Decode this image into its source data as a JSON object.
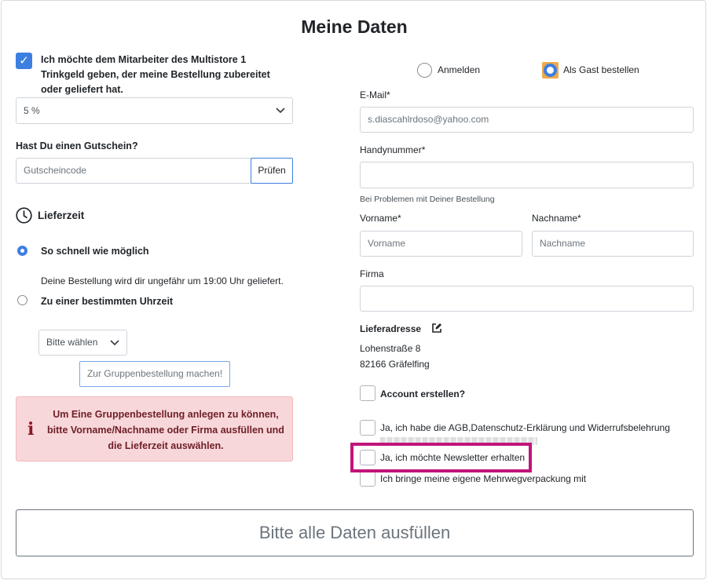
{
  "title": "Meine Daten",
  "tip": {
    "checked": true,
    "text": "Ich möchte dem Mitarbeiter des Multistore 1 Trinkgeld geben, der meine Bestellung zubereitet oder geliefert hat.",
    "selected": "5 %"
  },
  "voucher": {
    "label": "Hast Du einen Gutschein?",
    "placeholder": "Gutscheincode",
    "button": "Prüfen"
  },
  "delivery": {
    "heading": "Lieferzeit",
    "option_asap": "So schnell wie möglich",
    "asap_note": "Deine Bestellung wird dir ungefähr um 19:00 Uhr geliefert.",
    "option_time": "Zu einer bestimmten Uhrzeit",
    "time_select": "Bitte wählen",
    "group_button": "Zur Gruppenbestellung machen!"
  },
  "alert": {
    "icon": "info-icon",
    "text": "Um Eine Gruppenbestellung anlegen zu können, bitte Vorname/Nachname oder Firma ausfüllen und die Lieferzeit auswählen."
  },
  "login": {
    "option_login": "Anmelden",
    "option_guest": "Als Gast bestellen"
  },
  "form": {
    "email_label": "E-Mail*",
    "email_value": "s.diascahlrdoso@yahoo.com",
    "phone_label": "Handynummer*",
    "phone_hint": "Bei Problemen mit Deiner Bestellung",
    "firstname_label": "Vorname*",
    "firstname_placeholder": "Vorname",
    "lastname_label": "Nachname*",
    "lastname_placeholder": "Nachname",
    "company_label": "Firma"
  },
  "address": {
    "heading": "Lieferadresse",
    "street": "Lohenstraße 8",
    "city": "82166 Gräfelfing"
  },
  "checkboxes": {
    "account": "Account erstellen?",
    "terms": "Ja, ich habe die AGB,Datenschutz-Erklärung und Widerrufsbelehrung",
    "newsletter": "Ja, ich möchte Newsletter erhalten",
    "reusable": "Ich bringe meine eigene Mehrwegverpackung mit"
  },
  "submit": "Bitte alle Daten ausfüllen",
  "colors": {
    "accent": "#3d7fe0",
    "alert_bg": "#f8d7da",
    "highlight": "#c0157a"
  }
}
